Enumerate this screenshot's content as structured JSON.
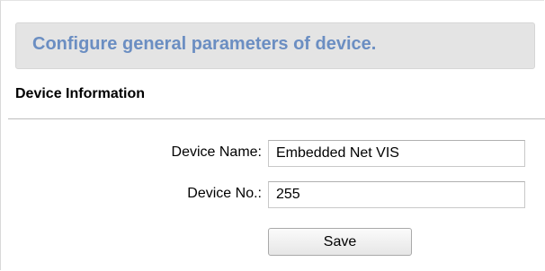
{
  "header": {
    "title": "Configure general parameters of device."
  },
  "section": {
    "title": "Device Information"
  },
  "form": {
    "device_name_label": "Device Name:",
    "device_name_value": "Embedded Net VIS",
    "device_no_label": "Device No.:",
    "device_no_value": "255",
    "save_label": "Save"
  },
  "colors": {
    "header_text": "#6b8ec2",
    "header_background": "#e4e4e4"
  }
}
